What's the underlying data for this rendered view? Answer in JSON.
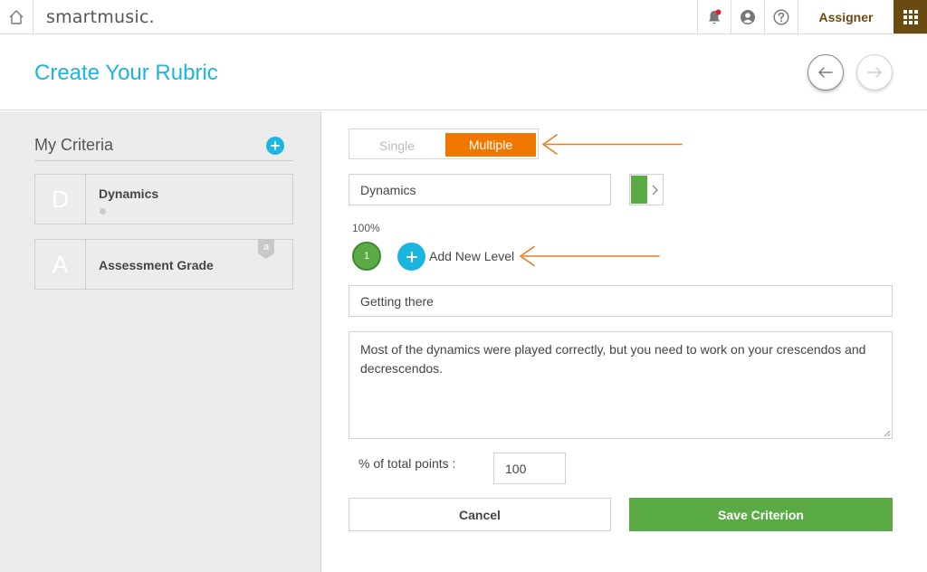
{
  "topbar": {
    "logo": "smartmusic.",
    "role_label": "Assigner",
    "icons": [
      "home-icon",
      "bell-icon",
      "user-circle-icon",
      "help-icon",
      "apps-grid-icon"
    ],
    "notification_dot_color": "#d9232e",
    "brand_color": "#6b4a12"
  },
  "header": {
    "title": "Create Your Rubric",
    "title_color": "#1cb5e0"
  },
  "sidebar": {
    "title": "My Criteria",
    "criteria": [
      {
        "letter": "D",
        "name": "Dynamics"
      },
      {
        "letter": "A",
        "name": "Assessment Grade",
        "badge": "a"
      }
    ]
  },
  "editor": {
    "mode_toggle": {
      "options": [
        "Single",
        "Multiple"
      ],
      "selected": "Multiple",
      "selected_color": "#f07800"
    },
    "criterion_name": "Dynamics",
    "criterion_color": "#5aaa45",
    "level_weight": "100%",
    "levels": [
      "1"
    ],
    "add_level_label": "Add New Level",
    "level_name": "Getting there",
    "level_description": "Most of the dynamics were played correctly, but you need to work on your crescendos and decrescendos.",
    "points_label": "% of total points :",
    "points_value": "100",
    "cancel_label": "Cancel",
    "save_label": "Save Criterion",
    "annotation_arrow_color": "#e87d1e"
  }
}
